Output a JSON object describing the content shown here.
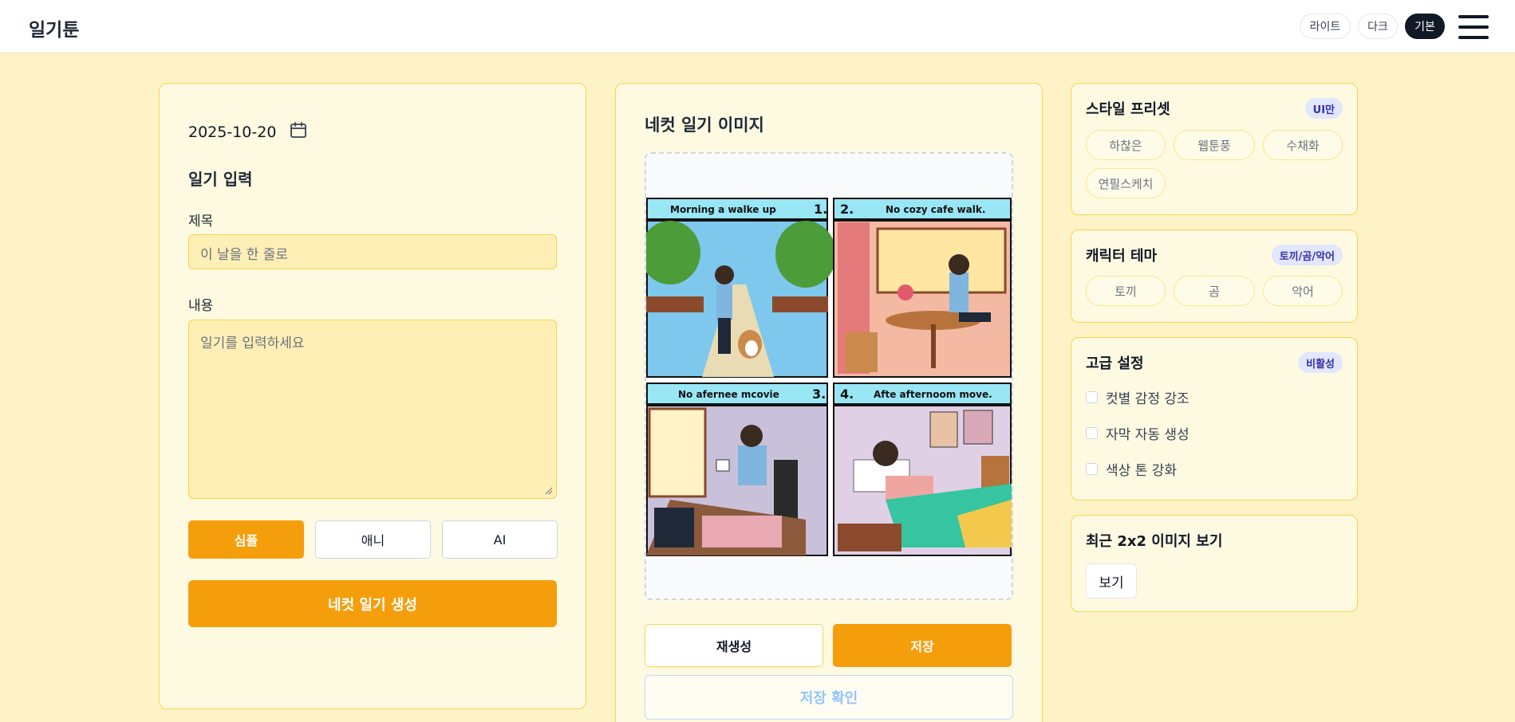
{
  "app": {
    "brand": "일기툰"
  },
  "header": {
    "theme_buttons": [
      {
        "label": "라이트",
        "active": false
      },
      {
        "label": "다크",
        "active": false
      },
      {
        "label": "기본",
        "active": true
      }
    ],
    "menu_icon": "hamburger-menu-icon"
  },
  "left_panel": {
    "date": "2025-10-20",
    "date_icon": "calendar-icon",
    "section_title": "일기 입력",
    "title_label": "제목",
    "title_placeholder": "이 날을 한 줄로",
    "content_label": "내용",
    "content_placeholder": "일기를 입력하세요",
    "modes": [
      {
        "label": "심플",
        "active": true
      },
      {
        "label": "애니",
        "active": false
      },
      {
        "label": "AI",
        "active": false
      }
    ],
    "generate_label": "네컷 일기 생성"
  },
  "center_panel": {
    "title": "네컷 일기 이미지",
    "comic_panels": [
      {
        "number": "1.",
        "caption": "Morning a walke up"
      },
      {
        "number": "2.",
        "caption": "No cozy cafe walk."
      },
      {
        "number": "3.",
        "caption": "No afernee mcovie"
      },
      {
        "number": "4.",
        "caption": "Afte afternoom move."
      }
    ],
    "regenerate_label": "재생성",
    "save_label": "저장",
    "confirm_label": "저장 확인"
  },
  "right_panel": {
    "style_preset": {
      "title": "스타일 프리셋",
      "badge": "UI만",
      "chips": [
        "하찮은",
        "웹툰풍",
        "수채화",
        "연필스케치"
      ]
    },
    "character_theme": {
      "title": "캐릭터 테마",
      "badge": "토끼/곰/악어",
      "chips": [
        "토끼",
        "곰",
        "악어"
      ]
    },
    "advanced": {
      "title": "고급 설정",
      "badge": "비활성",
      "options": [
        "컷별 감정 강조",
        "자막 자동 생성",
        "색상 톤 강화"
      ]
    },
    "recent": {
      "title": "최근 2x2 이미지 보기",
      "button": "보기"
    }
  },
  "colors": {
    "background": "#fef3c7",
    "accent": "#f59e0b",
    "card_border": "#fcd34d",
    "dark": "#111827"
  }
}
